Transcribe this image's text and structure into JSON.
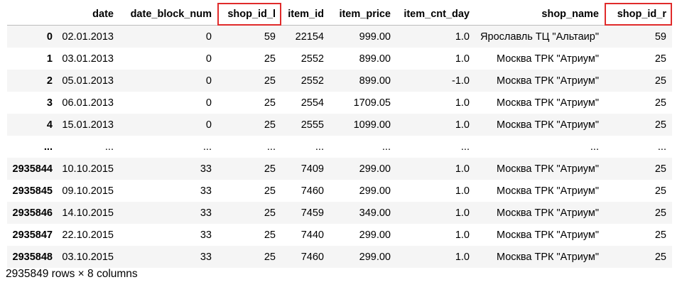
{
  "table": {
    "columns": [
      "",
      "date",
      "date_block_num",
      "shop_id_l",
      "item_id",
      "item_price",
      "item_cnt_day",
      "shop_name",
      "shop_id_r"
    ],
    "highlighted_columns": [
      "shop_id_l",
      "shop_id_r"
    ],
    "highlight_color": "#e02b2b",
    "rows": [
      [
        "0",
        "02.01.2013",
        "0",
        "59",
        "22154",
        "999.00",
        "1.0",
        "Ярославль ТЦ \"Альтаир\"",
        "59"
      ],
      [
        "1",
        "03.01.2013",
        "0",
        "25",
        "2552",
        "899.00",
        "1.0",
        "Москва ТРК \"Атриум\"",
        "25"
      ],
      [
        "2",
        "05.01.2013",
        "0",
        "25",
        "2552",
        "899.00",
        "-1.0",
        "Москва ТРК \"Атриум\"",
        "25"
      ],
      [
        "3",
        "06.01.2013",
        "0",
        "25",
        "2554",
        "1709.05",
        "1.0",
        "Москва ТРК \"Атриум\"",
        "25"
      ],
      [
        "4",
        "15.01.2013",
        "0",
        "25",
        "2555",
        "1099.00",
        "1.0",
        "Москва ТРК \"Атриум\"",
        "25"
      ],
      [
        "...",
        "...",
        "...",
        "...",
        "...",
        "...",
        "...",
        "...",
        "..."
      ],
      [
        "2935844",
        "10.10.2015",
        "33",
        "25",
        "7409",
        "299.00",
        "1.0",
        "Москва ТРК \"Атриум\"",
        "25"
      ],
      [
        "2935845",
        "09.10.2015",
        "33",
        "25",
        "7460",
        "299.00",
        "1.0",
        "Москва ТРК \"Атриум\"",
        "25"
      ],
      [
        "2935846",
        "14.10.2015",
        "33",
        "25",
        "7459",
        "349.00",
        "1.0",
        "Москва ТРК \"Атриум\"",
        "25"
      ],
      [
        "2935847",
        "22.10.2015",
        "33",
        "25",
        "7440",
        "299.00",
        "1.0",
        "Москва ТРК \"Атриум\"",
        "25"
      ],
      [
        "2935848",
        "03.10.2015",
        "33",
        "25",
        "7460",
        "299.00",
        "1.0",
        "Москва ТРК \"Атриум\"",
        "25"
      ]
    ]
  },
  "footer": "2935849 rows × 8 columns"
}
